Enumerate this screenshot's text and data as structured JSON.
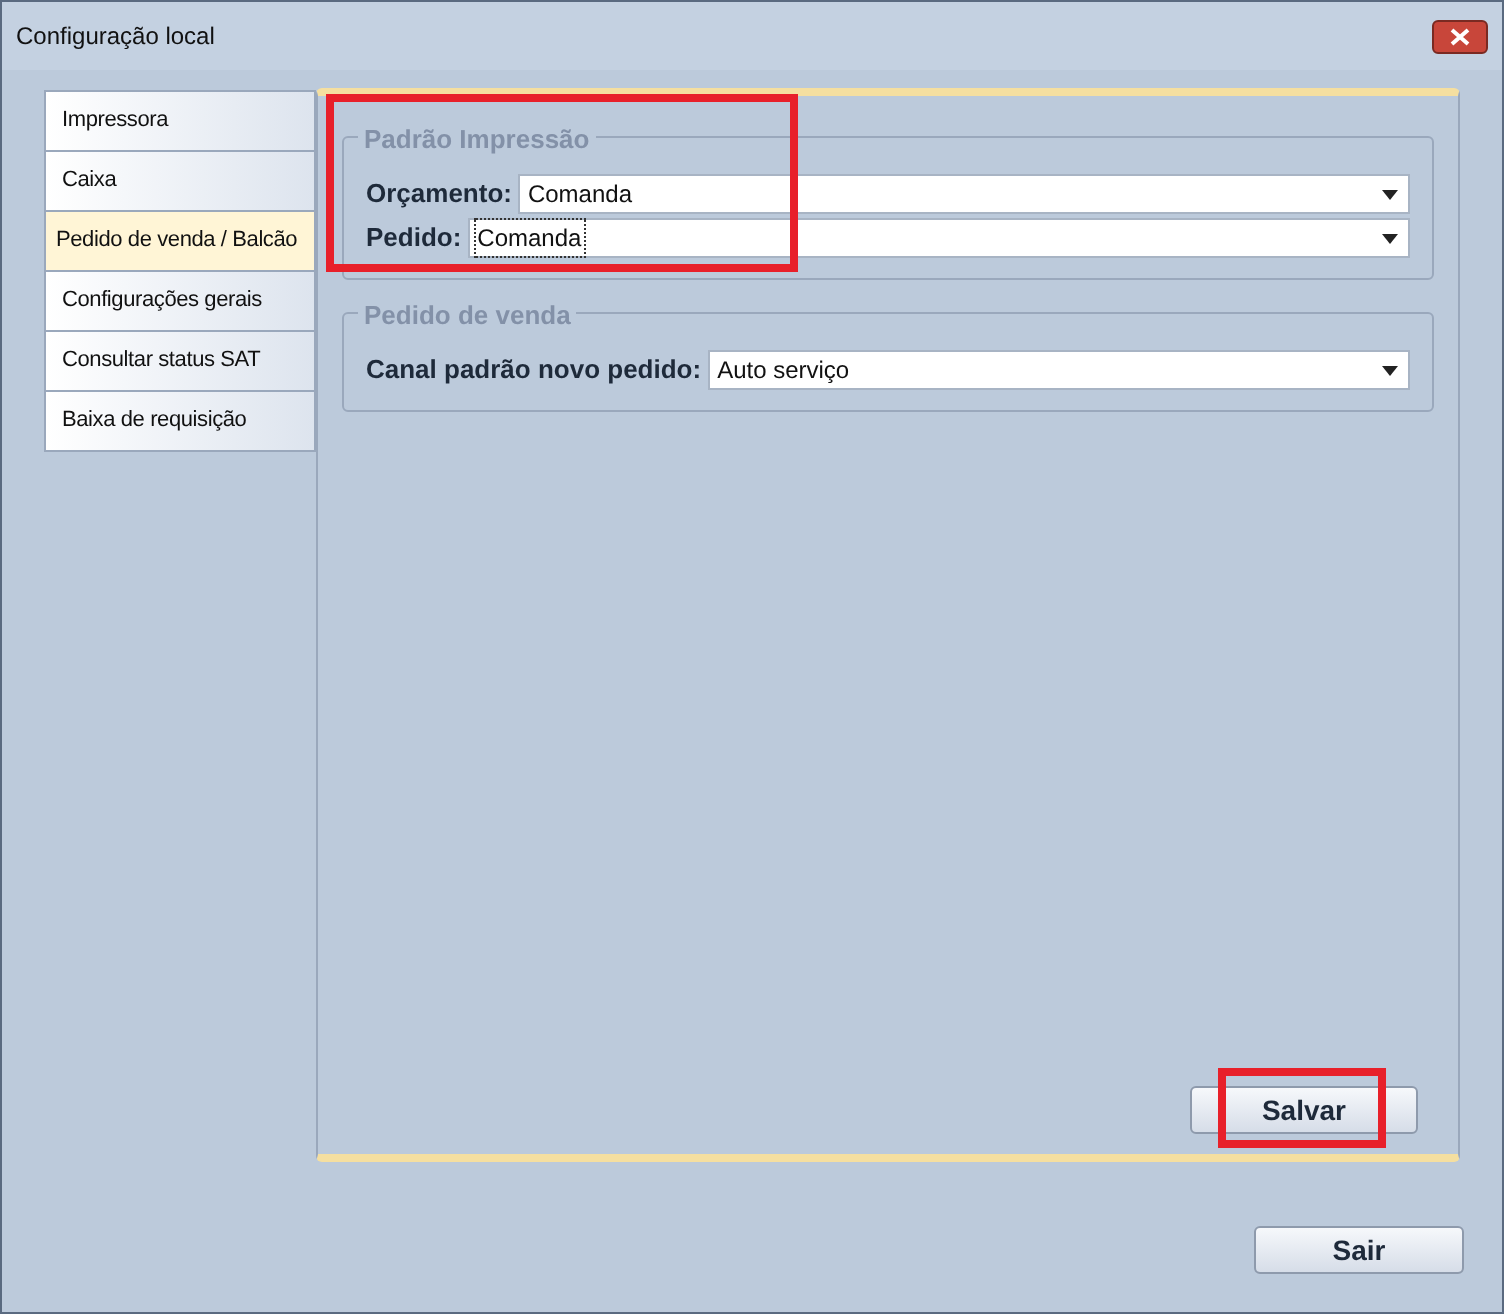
{
  "window": {
    "title": "Configuração local"
  },
  "tabs": [
    {
      "label": "Impressora",
      "selected": false
    },
    {
      "label": "Caixa",
      "selected": false
    },
    {
      "label": "Pedido de venda / Balcão",
      "selected": true
    },
    {
      "label": "Configurações gerais",
      "selected": false
    },
    {
      "label": "Consultar status SAT",
      "selected": false
    },
    {
      "label": "Baixa de requisição",
      "selected": false
    }
  ],
  "groups": [
    {
      "title": "Padrão Impressão",
      "highlighted": true,
      "fields": [
        {
          "label": "Orçamento:",
          "value": "Comanda",
          "focused": false
        },
        {
          "label": "Pedido:",
          "value": "Comanda",
          "focused": true
        }
      ]
    },
    {
      "title": "Pedido de venda",
      "fields": [
        {
          "label": "Canal padrão novo pedido:",
          "value": "Auto serviço",
          "focused": false
        }
      ]
    }
  ],
  "save_button": {
    "label": "Salvar",
    "highlighted": true
  },
  "exit_button": {
    "label": "Sair"
  }
}
